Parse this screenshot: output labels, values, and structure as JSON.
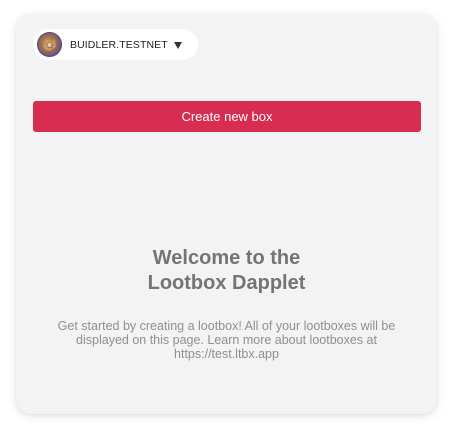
{
  "account": {
    "avatar_icon": "lootbox-avatar-icon",
    "network_label": "BUIDLER.TESTNET",
    "dropdown_icon": "caret-down-icon"
  },
  "actions": {
    "create_box_label": "Create new box"
  },
  "welcome": {
    "title_line1": "Welcome to the",
    "title_line2": "Lootbox Dapplet",
    "description": "Get started by creating a lootbox! All of your lootboxes will be displayed on this page. Learn more about lootboxes at https://test.ltbx.app"
  },
  "colors": {
    "accent": "#d82c50",
    "card_background": "#f3f3f3",
    "title_text": "#747474",
    "body_text": "#8f8f8f"
  }
}
